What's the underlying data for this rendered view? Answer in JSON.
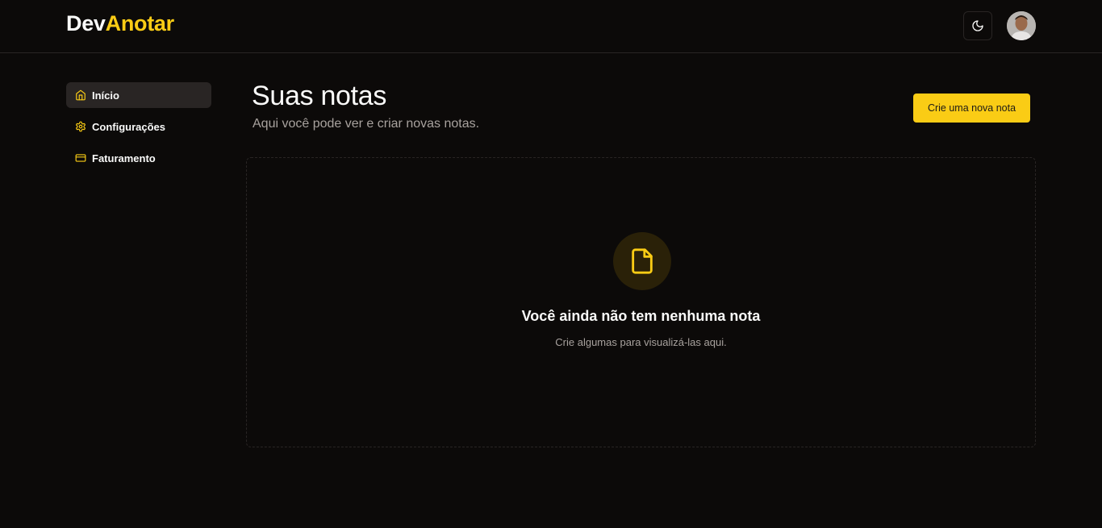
{
  "app": {
    "logo_part1": "Dev",
    "logo_part2": "Anotar",
    "accent_color": "#facc15"
  },
  "header": {
    "theme_toggle_icon": "moon-icon",
    "avatar_icon": "user-avatar"
  },
  "sidebar": {
    "items": [
      {
        "label": "Início",
        "icon": "home-icon",
        "active": true
      },
      {
        "label": "Configurações",
        "icon": "gear-icon",
        "active": false
      },
      {
        "label": "Faturamento",
        "icon": "credit-card-icon",
        "active": false
      }
    ]
  },
  "main": {
    "title": "Suas notas",
    "subtitle": "Aqui você pode ver e criar novas notas.",
    "new_note_label": "Crie uma nova nota",
    "empty_state": {
      "icon": "file-icon",
      "title": "Você ainda não tem nenhuma nota",
      "description": "Crie algumas para visualizá-las aqui."
    }
  }
}
